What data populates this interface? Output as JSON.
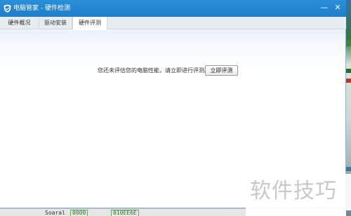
{
  "window": {
    "title": "电脑管家 - 硬件检测",
    "minimize_glyph": "—",
    "close_glyph": "✕"
  },
  "tabs": [
    {
      "label": "硬件概况",
      "active": false
    },
    {
      "label": "驱动安装",
      "active": false
    },
    {
      "label": "硬件评测",
      "active": true
    }
  ],
  "main": {
    "prompt": "您还未评估您的电脑性能，请立即进行评测。",
    "eval_button_label": "立即评测"
  },
  "background": {
    "bottom_cells": [
      "Soaral",
      "0000",
      "010EE6E"
    ]
  },
  "watermark": {
    "text": "软件技巧"
  },
  "colors": {
    "titlebar": "#1f7ec9",
    "tabbar": "#e8edf3",
    "content_top": "#f3f8fd"
  }
}
